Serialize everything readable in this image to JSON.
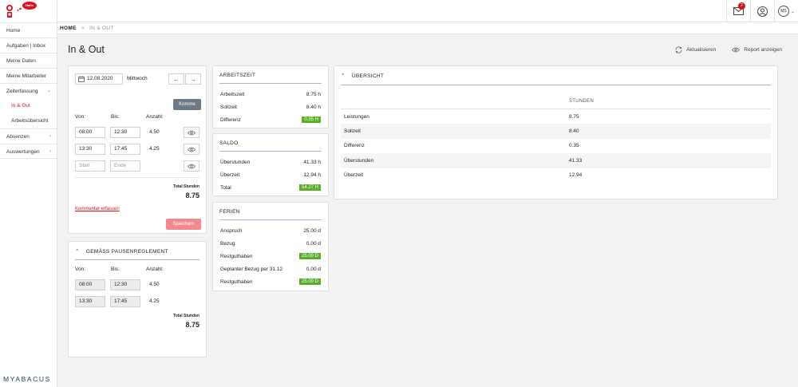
{
  "sidebar": {
    "logo_bubble": "Hallo",
    "items": [
      {
        "label": "Home"
      },
      {
        "label": "Aufgaben | Inbox"
      },
      {
        "label": "Meine Daten"
      },
      {
        "label": "Meine Mitarbeiter"
      },
      {
        "label": "Zeiterfassung"
      },
      {
        "label": "In & Out"
      },
      {
        "label": "Arbeitsübersicht"
      },
      {
        "label": "Absenzen"
      },
      {
        "label": "Auswertungen"
      }
    ],
    "brand": "MYABACUS"
  },
  "topbar": {
    "badge_count": "2",
    "avatar": "MS"
  },
  "breadcrumb": {
    "home": "HOME",
    "sep": ">",
    "current": "IN & OUT"
  },
  "page": {
    "title": "In & Out",
    "refresh_label": "Aktualisieren",
    "report_label": "Report anzeigen"
  },
  "inout": {
    "date": "12.08.2020",
    "weekday": "Mittwoch",
    "komme_label": "Komme",
    "von_label": "Von:",
    "bis_label": "Bis:",
    "anzahl_label": "Anzahl:",
    "rows": [
      {
        "von": "08:00",
        "bis": "12:30",
        "anzahl": "4.50"
      },
      {
        "von": "13:30",
        "bis": "17:45",
        "anzahl": "4.25"
      }
    ],
    "start_placeholder": "Start",
    "ende_placeholder": "Ende",
    "total_label": "Total Stunden",
    "total_value": "8.75",
    "comment_link": "Kommentar erfassen",
    "save_label": "Speichern"
  },
  "pausen": {
    "title": "GEMÄSS PAUSENREGLEMENT",
    "von_label": "Von:",
    "bis_label": "Bis:",
    "anzahl_label": "Anzahl:",
    "rows": [
      {
        "von": "08:00",
        "bis": "12:30",
        "anzahl": "4.50"
      },
      {
        "von": "13:30",
        "bis": "17:45",
        "anzahl": "4.25"
      }
    ],
    "total_label": "Total Stunden",
    "total_value": "8.75"
  },
  "arbeitszeit": {
    "title": "ARBEITSZEIT",
    "rows": [
      {
        "label": "Arbeitszeit",
        "value": "8.75 h"
      },
      {
        "label": "Sollzeit",
        "value": "8.40 h"
      },
      {
        "label": "Differenz",
        "value": "0.35 H"
      }
    ]
  },
  "saldo": {
    "title": "SALDO",
    "rows": [
      {
        "label": "Überstunden",
        "value": "41.33 h"
      },
      {
        "label": "Überzeit",
        "value": "12.94 h"
      },
      {
        "label": "Total",
        "value": "54.27 H"
      }
    ]
  },
  "ferien": {
    "title": "FERIEN",
    "rows": [
      {
        "label": "Anspruch",
        "value": "25.00 d"
      },
      {
        "label": "Bezug",
        "value": "0.00 d"
      },
      {
        "label": "Restguthaben",
        "value": "25.00 D"
      },
      {
        "label": "Geplanter Bezug per 31.12",
        "value": "0.00 d"
      },
      {
        "label": "Restguthaben",
        "value": "25.00 D"
      }
    ]
  },
  "uebersicht": {
    "title": "ÜBERSICHT",
    "column": "STUNDEN",
    "rows": [
      {
        "label": "Leistungen",
        "value": "8.75"
      },
      {
        "label": "Sollzeit",
        "value": "8.40"
      },
      {
        "label": "Differenz",
        "value": "0.35"
      },
      {
        "label": "Überstunden",
        "value": "41.33"
      },
      {
        "label": "Überzeit",
        "value": "12.94"
      }
    ]
  },
  "colors": {
    "accent_red": "#d8121f",
    "green": "#59b028",
    "save_button": "#f08a8f",
    "komme_button": "#6e7a86"
  }
}
